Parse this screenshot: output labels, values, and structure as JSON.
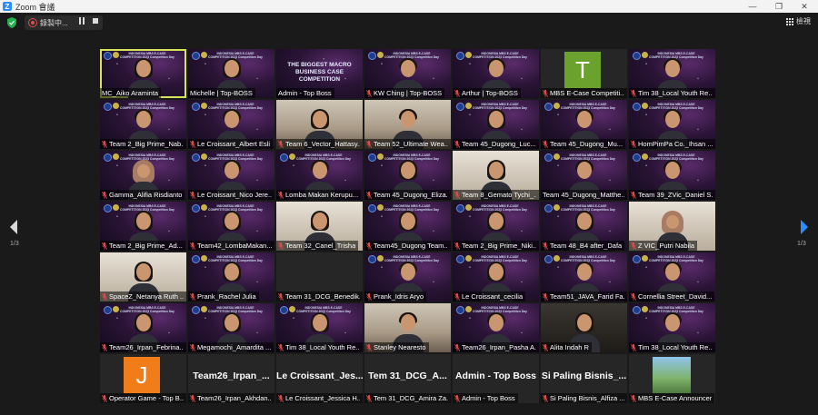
{
  "window": {
    "title": "Zoom 會議",
    "logo_letter": "Z",
    "minimize": "—",
    "maximize": "❐",
    "close": "✕"
  },
  "toolbar": {
    "recording_label": "錄製中...",
    "view_label": "檢視"
  },
  "pagination": {
    "left_page": "1/3",
    "right_page": "1/3"
  },
  "colors": {
    "active_speaker_border": "#d6e35a",
    "muted_mic": "#e14b4b",
    "avatar_T": "#6aa22d",
    "avatar_J": "#f07c1a"
  },
  "competition_slide": {
    "small_title": "INDONESIA MBS E-CASE COMPETITION 2023 Competition Day",
    "macro_title": "THE BIGGEST MACRO BUSINESS CASE COMPETITION"
  },
  "participants": [
    {
      "name": "MC_Aiko Araminta",
      "muted": false,
      "bg": "space",
      "person": "woman",
      "active": true
    },
    {
      "name": "Michelle | Top-BOSS",
      "muted": false,
      "bg": "space",
      "person": "woman"
    },
    {
      "name": "Admin - Top Boss",
      "muted": false,
      "bg": "macro"
    },
    {
      "name": "KW Ching | Top-BOSS",
      "muted": true,
      "bg": "space",
      "person": "man"
    },
    {
      "name": "Arthur | Top-BOSS",
      "muted": true,
      "bg": "space",
      "person": "man"
    },
    {
      "name": "MBS E-Case Competiti...",
      "muted": true,
      "bg": "avatar",
      "avatar": "T"
    },
    {
      "name": "Tim 38_Local Youth Re...",
      "muted": true,
      "bg": "space",
      "person": "man"
    },
    {
      "name": "Team 2_Big Prime_Nab...",
      "muted": true,
      "bg": "space",
      "person": "man"
    },
    {
      "name": "Le Croissant_Albert Esli",
      "muted": true,
      "bg": "space",
      "person": "man"
    },
    {
      "name": "Team 6_Vector_Hattasy...",
      "muted": true,
      "bg": "room",
      "person": "woman"
    },
    {
      "name": "Team 52_Ultimate Wea...",
      "muted": true,
      "bg": "room",
      "person": "man"
    },
    {
      "name": "Team 45_Dugong_Luc...",
      "muted": true,
      "bg": "space",
      "person": "woman"
    },
    {
      "name": "Team 45_Dugong_Mu...",
      "muted": true,
      "bg": "space",
      "person": "man"
    },
    {
      "name": "HomPimPa Co._Ihsan ...",
      "muted": true,
      "bg": "space",
      "person": "man"
    },
    {
      "name": "Gamma_Alifia Risdianto",
      "muted": true,
      "bg": "space",
      "person": "hijab"
    },
    {
      "name": "Le Croissant_Nico Jere...",
      "muted": true,
      "bg": "space",
      "person": "man"
    },
    {
      "name": "Lomba Makan Kerupu...",
      "muted": true,
      "bg": "space",
      "person": "man"
    },
    {
      "name": "Team 45_Dugong_Eliza...",
      "muted": true,
      "bg": "space",
      "person": "woman"
    },
    {
      "name": "Team 8_Gemato Tychi_...",
      "muted": true,
      "bg": "room2",
      "person": "woman"
    },
    {
      "name": "Team 45_Dugong_Matthe...",
      "muted": false,
      "bg": "space",
      "person": "man"
    },
    {
      "name": "Team 39_ZVic_Daniel S...",
      "muted": true,
      "bg": "space",
      "person": "man"
    },
    {
      "name": "Team 2_Big Prime_Ad...",
      "muted": true,
      "bg": "space",
      "person": "woman"
    },
    {
      "name": "Team42_LombaMakan...",
      "muted": true,
      "bg": "space",
      "person": "woman"
    },
    {
      "name": "Team 32_Canel_Trisha",
      "muted": true,
      "bg": "room2",
      "person": "woman"
    },
    {
      "name": "Team45_Dugong Team...",
      "muted": true,
      "bg": "space",
      "person": "woman"
    },
    {
      "name": "Team 2_Big Prime_Niki...",
      "muted": true,
      "bg": "space",
      "person": "woman"
    },
    {
      "name": "Team 48_B4 after_Dafa",
      "muted": true,
      "bg": "space",
      "person": "woman"
    },
    {
      "name": "Z VIC_Putri Nabila",
      "muted": true,
      "bg": "room2",
      "person": "hijab"
    },
    {
      "name": "SpaceZ_Netanya Ruth ...",
      "muted": true,
      "bg": "room2",
      "person": "woman"
    },
    {
      "name": "Prank_Rachel Julia",
      "muted": true,
      "bg": "space",
      "person": "woman"
    },
    {
      "name": "Team 31_DCG_Benedik...",
      "muted": true,
      "bg": "gray"
    },
    {
      "name": "Prank_Idris Aryo",
      "muted": true,
      "bg": "space",
      "person": "man"
    },
    {
      "name": "Le Croissant_cecilia",
      "muted": true,
      "bg": "space",
      "person": "woman"
    },
    {
      "name": "Team51_JAVA_Farid Fa...",
      "muted": true,
      "bg": "space",
      "person": "man"
    },
    {
      "name": "Cornellia Street_David...",
      "muted": true,
      "bg": "space",
      "person": "man"
    },
    {
      "name": "Team26_Irpan_Febrina...",
      "muted": true,
      "bg": "space",
      "person": "woman"
    },
    {
      "name": "Megamochi_Amardita ...",
      "muted": true,
      "bg": "space",
      "person": "woman"
    },
    {
      "name": "Tim 38_Local Youth Re...",
      "muted": true,
      "bg": "space",
      "person": "woman"
    },
    {
      "name": "Stanley Nearesto",
      "muted": true,
      "bg": "room",
      "person": "man"
    },
    {
      "name": "Team26_Irpan_Pasha A...",
      "muted": true,
      "bg": "space",
      "person": "man"
    },
    {
      "name": "Alita Indah R",
      "muted": true,
      "bg": "dim",
      "person": "woman"
    },
    {
      "name": "Tim 38_Local Youth Re...",
      "muted": true,
      "bg": "space",
      "person": "man"
    },
    {
      "name": "Operator Game - Top B...",
      "muted": true,
      "bg": "avatar",
      "avatar": "J"
    },
    {
      "name": "Team26_Irpan_Akhdan...",
      "muted": true,
      "bg": "bigname",
      "big_name": "Team26_Irpan_..."
    },
    {
      "name": "Le Croissant_Jessica H...",
      "muted": true,
      "bg": "bigname",
      "big_name": "Le Croissant_Jes..."
    },
    {
      "name": "Tem 31_DCG_Amira Za...",
      "muted": true,
      "bg": "bigname",
      "big_name": "Tem 31_DCG_A..."
    },
    {
      "name": "Admin - Top Boss",
      "muted": true,
      "bg": "bigname",
      "big_name": "Admin - Top Boss"
    },
    {
      "name": "Si Paling Bisnis_Alfiza ...",
      "muted": true,
      "bg": "bigname",
      "big_name": "Si Paling Bisnis_..."
    },
    {
      "name": "MBS E-Case Announcer",
      "muted": true,
      "bg": "image"
    }
  ]
}
